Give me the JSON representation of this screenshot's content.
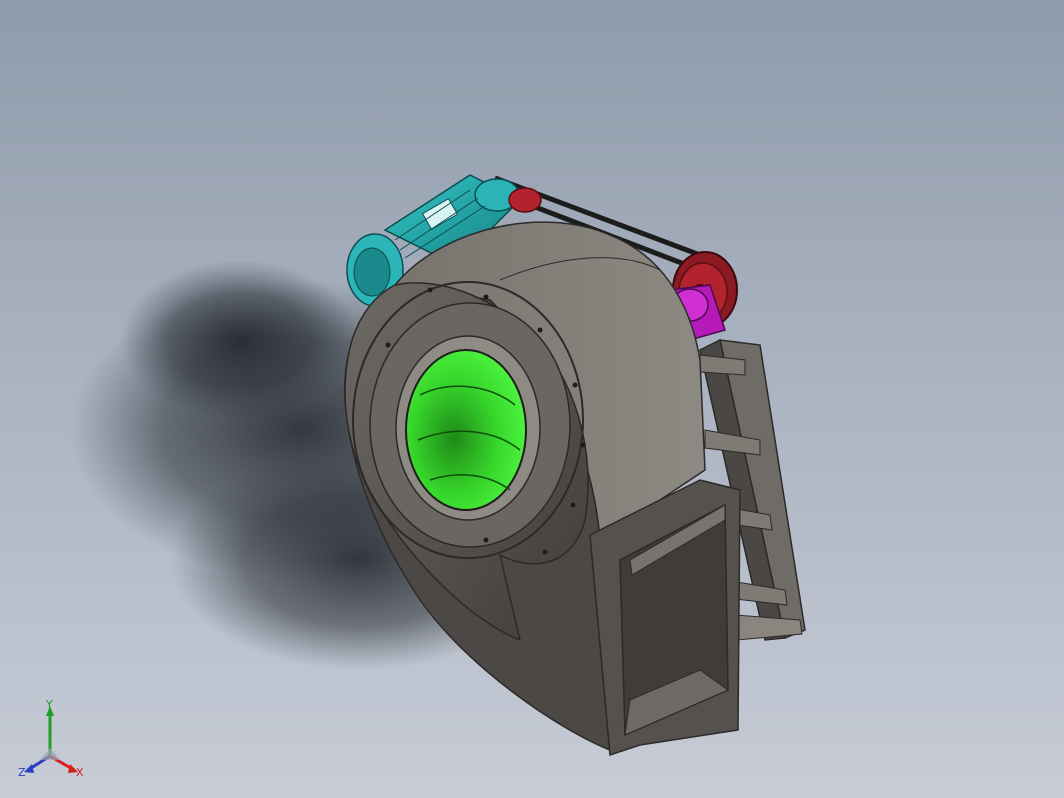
{
  "viewport": {
    "background_top": "#8f9bab",
    "background_bottom": "#c7ccd6"
  },
  "model": {
    "housing_color": "#55524e",
    "inlet_color": "#2fe02a",
    "motor_color": "#1ea5a8",
    "pulley_color": "#b2232e",
    "bearing_color": "#b51ab8",
    "belt_color": "#222222"
  },
  "triad": {
    "x_label": "X",
    "y_label": "Y",
    "z_label": "Z",
    "x_color": "#d81e1e",
    "y_color": "#1f9d2c",
    "z_color": "#2a3fbf"
  }
}
